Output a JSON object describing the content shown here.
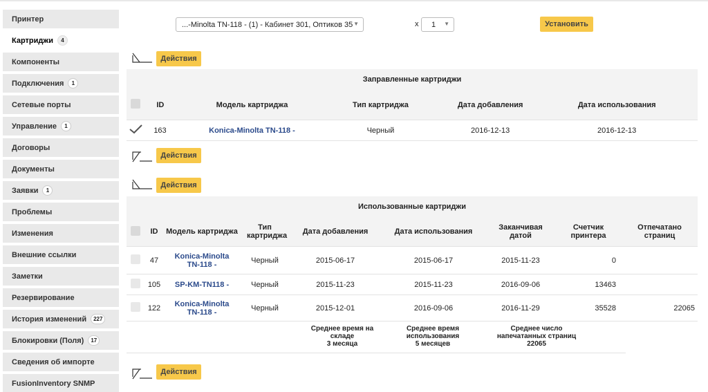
{
  "sidebar": {
    "items": [
      {
        "label": "Принтер",
        "badge": ""
      },
      {
        "label": "Картриджи",
        "badge": "4"
      },
      {
        "label": "Компоненты",
        "badge": ""
      },
      {
        "label": "Подключения",
        "badge": "1"
      },
      {
        "label": "Сетевые порты",
        "badge": ""
      },
      {
        "label": "Управление",
        "badge": "1"
      },
      {
        "label": "Договоры",
        "badge": ""
      },
      {
        "label": "Документы",
        "badge": ""
      },
      {
        "label": "Заявки",
        "badge": "1"
      },
      {
        "label": "Проблемы",
        "badge": ""
      },
      {
        "label": "Изменения",
        "badge": ""
      },
      {
        "label": "Внешние ссылки",
        "badge": ""
      },
      {
        "label": "Заметки",
        "badge": ""
      },
      {
        "label": "Резервирование",
        "badge": ""
      },
      {
        "label": "История изменений",
        "badge": "227"
      },
      {
        "label": "Блокировки (Поля)",
        "badge": "17"
      },
      {
        "label": "Сведения об импорте",
        "badge": ""
      },
      {
        "label": "FusionInventory SNMP",
        "badge": ""
      }
    ],
    "active_index": 1
  },
  "controls": {
    "cartridge_select": "...-Minolta TN-118 - (1) - Кабинет 301, Оптиков 35",
    "x_label": "x",
    "quantity_select": "1",
    "install_button": "Установить",
    "actions_button": "Действия"
  },
  "filled": {
    "title": "Заправленные картриджи",
    "headers": [
      "ID",
      "Модель картриджа",
      "Тип картриджа",
      "Дата добавления",
      "Дата использования"
    ],
    "rows": [
      {
        "id": "163",
        "model": "Konica-Minolta TN-118 -",
        "type": "Черный",
        "added": "2016-12-13",
        "used": "2016-12-13"
      }
    ]
  },
  "used": {
    "title": "Использованные картриджи",
    "headers": {
      "id": "ID",
      "model": "Модель картриджа",
      "type": "Тип картриджа",
      "added": "Дата добавления",
      "used": "Дата использования",
      "ended": "Заканчивая датой",
      "counter": "Счетчик принтера",
      "printed": "Отпечатано страниц"
    },
    "rows": [
      {
        "id": "47",
        "model": "Konica-Minolta TN-118 -",
        "type": "Черный",
        "added": "2015-06-17",
        "used": "2015-06-17",
        "ended": "2015-11-23",
        "counter": "0",
        "printed": ""
      },
      {
        "id": "105",
        "model": "SP-KM-TN118 -",
        "type": "Черный",
        "added": "2015-11-23",
        "used": "2015-11-23",
        "ended": "2016-09-06",
        "counter": "13463",
        "printed": ""
      },
      {
        "id": "122",
        "model": "Konica-Minolta TN-118 -",
        "type": "Черный",
        "added": "2015-12-01",
        "used": "2016-09-06",
        "ended": "2016-11-29",
        "counter": "35528",
        "printed": "22065"
      }
    ],
    "footer": {
      "avg_stock_label": "Среднее время на складе",
      "avg_stock_value": "3 месяца",
      "avg_use_label": "Среднее время использования",
      "avg_use_value": "5 месяцев",
      "avg_pages_label": "Среднее число напечатанных страниц",
      "avg_pages_value": "22065"
    }
  }
}
